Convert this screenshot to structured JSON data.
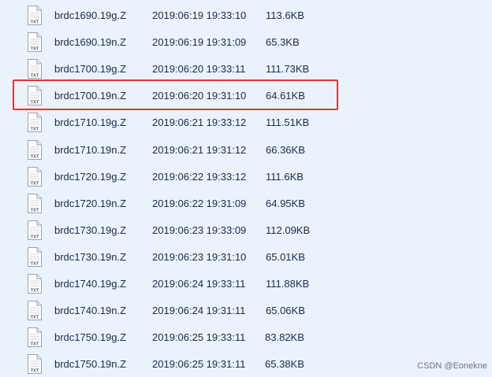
{
  "files": [
    {
      "name": "brdc1690.19g.Z",
      "modified": "2019:06:19 19:33:10",
      "size": "113.6KB",
      "icon": "txt-file-icon",
      "icon_label": "TXT"
    },
    {
      "name": "brdc1690.19n.Z",
      "modified": "2019:06:19 19:31:09",
      "size": "65.3KB",
      "icon": "txt-file-icon",
      "icon_label": "TXT"
    },
    {
      "name": "brdc1700.19g.Z",
      "modified": "2019:06:20 19:33:11",
      "size": "111.73KB",
      "icon": "txt-file-icon",
      "icon_label": "TXT"
    },
    {
      "name": "brdc1700.19n.Z",
      "modified": "2019:06:20 19:31:10",
      "size": "64.61KB",
      "icon": "txt-file-icon",
      "icon_label": "TXT",
      "highlighted": true
    },
    {
      "name": "brdc1710.19g.Z",
      "modified": "2019:06:21 19:33:12",
      "size": "111.51KB",
      "icon": "txt-file-icon",
      "icon_label": "TXT"
    },
    {
      "name": "brdc1710.19n.Z",
      "modified": "2019:06:21 19:31:12",
      "size": "66.36KB",
      "icon": "txt-file-icon",
      "icon_label": "TXT"
    },
    {
      "name": "brdc1720.19g.Z",
      "modified": "2019:06:22 19:33:12",
      "size": "111.6KB",
      "icon": "txt-file-icon",
      "icon_label": "TXT"
    },
    {
      "name": "brdc1720.19n.Z",
      "modified": "2019:06:22 19:31:09",
      "size": "64.95KB",
      "icon": "txt-file-icon",
      "icon_label": "TXT"
    },
    {
      "name": "brdc1730.19g.Z",
      "modified": "2019:06:23 19:33:09",
      "size": "112.09KB",
      "icon": "txt-file-icon",
      "icon_label": "TXT"
    },
    {
      "name": "brdc1730.19n.Z",
      "modified": "2019:06:23 19:31:10",
      "size": "65.01KB",
      "icon": "txt-file-icon",
      "icon_label": "TXT"
    },
    {
      "name": "brdc1740.19g.Z",
      "modified": "2019:06:24 19:33:11",
      "size": "111.88KB",
      "icon": "txt-file-icon",
      "icon_label": "TXT"
    },
    {
      "name": "brdc1740.19n.Z",
      "modified": "2019:06:24 19:31:11",
      "size": "65.06KB",
      "icon": "txt-file-icon",
      "icon_label": "TXT"
    },
    {
      "name": "brdc1750.19g.Z",
      "modified": "2019:06:25 19:33:11",
      "size": "83.82KB",
      "icon": "txt-file-icon",
      "icon_label": "TXT"
    },
    {
      "name": "brdc1750.19n.Z",
      "modified": "2019:06:25 19:31:11",
      "size": "65.38KB",
      "icon": "txt-file-icon",
      "icon_label": "TXT"
    }
  ],
  "highlight_color": "#e53333",
  "background_color": "#eaf2fb",
  "watermark": "CSDN @Eonekne"
}
